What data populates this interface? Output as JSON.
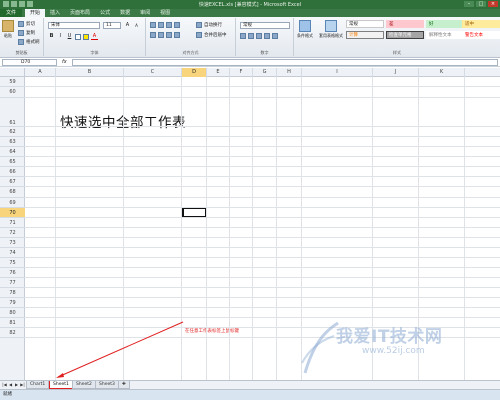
{
  "titlebar": {
    "title": "快速EXCEL.xls [兼容模式] - Microsoft Excel"
  },
  "tabs": [
    "文件",
    "开始",
    "插入",
    "页面布局",
    "公式",
    "数据",
    "审阅",
    "视图"
  ],
  "ribbon": {
    "clipboard": {
      "paste": "粘贴",
      "cut": "剪切",
      "copy": "复制",
      "format_painter": "格式刷",
      "label": "剪贴板"
    },
    "font": {
      "name": "宋体",
      "size": "11",
      "label": "字体"
    },
    "alignment": {
      "wrap": "自动换行",
      "merge": "合并后居中",
      "label": "对齐方式"
    },
    "number": {
      "format": "常规",
      "label": "数字"
    },
    "styles": {
      "cond": "条件格式",
      "table": "套用表格格式",
      "cells": [
        {
          "label": "常规",
          "bg": "#ffffff",
          "fg": "#222222",
          "border": "#c9c9c9"
        },
        {
          "label": "差",
          "bg": "#ffc7ce",
          "fg": "#9c0006",
          "border": "#ffc7ce"
        },
        {
          "label": "好",
          "bg": "#c6efce",
          "fg": "#006100",
          "border": "#c6efce"
        },
        {
          "label": "适中",
          "bg": "#ffeb9c",
          "fg": "#9c5700",
          "border": "#ffeb9c"
        },
        {
          "label": "计算",
          "bg": "#f2f2f2",
          "fg": "#fa7d00",
          "border": "#7f7f7f"
        },
        {
          "label": "检查单元格",
          "bg": "#a5a5a5",
          "fg": "#ffffff",
          "border": "#3f3f3f"
        },
        {
          "label": "解释性文本",
          "bg": "#ffffff",
          "fg": "#7f7f7f",
          "border": "#ffffff"
        },
        {
          "label": "警告文本",
          "bg": "#ffffff",
          "fg": "#ff0000",
          "border": "#ffffff"
        }
      ],
      "label": "样式"
    }
  },
  "formula_bar": {
    "name_box": "D70",
    "fx": "fx"
  },
  "columns": [
    "A",
    "B",
    "C",
    "D",
    "E",
    "F",
    "G",
    "H",
    "I",
    "J",
    "K"
  ],
  "selected_column": "D",
  "rows": [
    "59",
    "60",
    "61",
    "62",
    "63",
    "64",
    "65",
    "66",
    "67",
    "68",
    "69",
    "70",
    "71",
    "72",
    "73",
    "74",
    "75",
    "76",
    "77",
    "78",
    "79",
    "80",
    "81",
    "82"
  ],
  "selected_row": "70",
  "content": {
    "heading": "快速选中全部工作表",
    "annotation": "在任意工作表标签上鼠标键"
  },
  "sheets": [
    {
      "name": "Chart1",
      "active": false
    },
    {
      "name": "Sheet1",
      "active": true
    },
    {
      "name": "Sheet2",
      "active": false
    },
    {
      "name": "Sheet3",
      "active": false
    }
  ],
  "watermark": {
    "text": "我爱IT技术网",
    "url": "www.52ij.com"
  },
  "status": {
    "text": "就绪"
  },
  "colors": {
    "accent": "#2f6f3a",
    "annotation": "#e02020",
    "selection": "#f8d47c"
  }
}
